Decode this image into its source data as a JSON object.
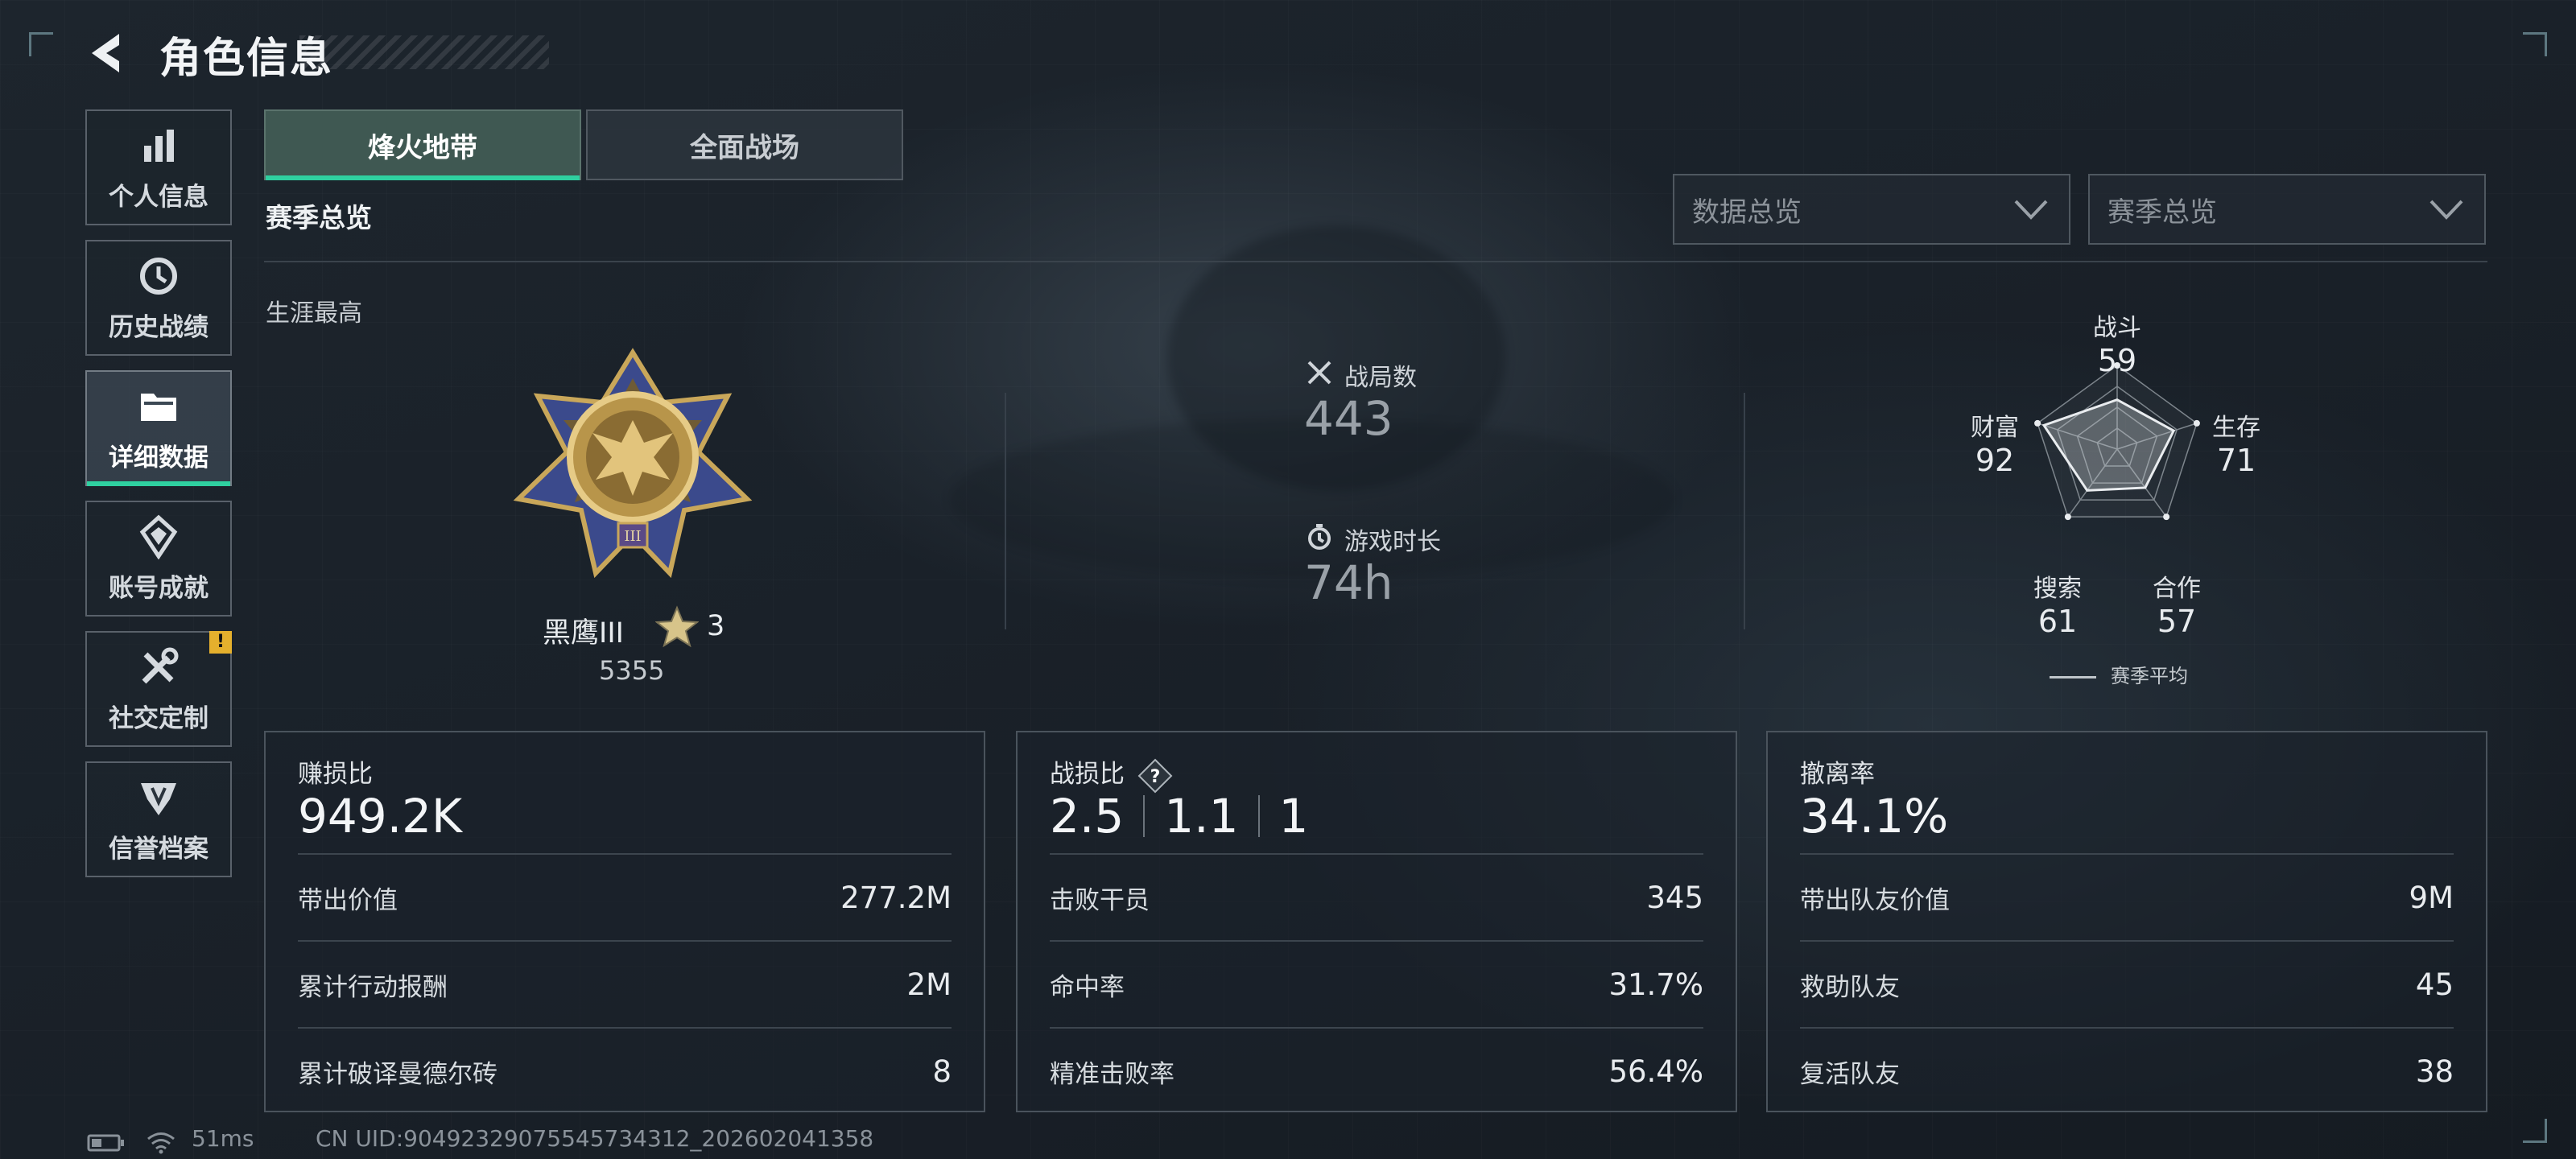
{
  "header": {
    "title": "角色信息"
  },
  "sidebar": {
    "items": [
      {
        "label": "个人信息",
        "icon": "bar-chart-icon"
      },
      {
        "label": "历史战绩",
        "icon": "history-clock-icon"
      },
      {
        "label": "详细数据",
        "icon": "folder-icon",
        "active": true
      },
      {
        "label": "账号成就",
        "icon": "achievement-icon"
      },
      {
        "label": "社交定制",
        "icon": "tools-icon",
        "badge": "!"
      },
      {
        "label": "信誉档案",
        "icon": "credit-emblem-icon"
      }
    ]
  },
  "tabs": [
    {
      "label": "烽火地带",
      "active": true
    },
    {
      "label": "全面战场"
    }
  ],
  "section_title": "赛季总览",
  "filters": {
    "data_overview": "数据总览",
    "season_overview": "赛季总览"
  },
  "career": {
    "label": "生涯最高",
    "rank_name": "黑鹰III",
    "stars": "3",
    "score": "5355"
  },
  "stats": {
    "matches_label": "战局数",
    "matches_value": "443",
    "playtime_label": "游戏时长",
    "playtime_value": "74h"
  },
  "radar": {
    "combat": {
      "label": "战斗",
      "value": "59"
    },
    "survival": {
      "label": "生存",
      "value": "71"
    },
    "teamwork": {
      "label": "合作",
      "value": "57"
    },
    "search": {
      "label": "搜索",
      "value": "61"
    },
    "wealth": {
      "label": "财富",
      "value": "92"
    },
    "legend": "赛季平均",
    "chart_data": {
      "type": "radar",
      "axes": [
        "战斗",
        "生存",
        "合作",
        "搜索",
        "财富"
      ],
      "values": [
        59,
        71,
        57,
        61,
        92
      ],
      "range": [
        0,
        100
      ]
    }
  },
  "cards": {
    "profit": {
      "title": "赚损比",
      "big": "949.2K",
      "rows": [
        {
          "k": "带出价值",
          "v": "277.2M"
        },
        {
          "k": "累计行动报酬",
          "v": "2M"
        },
        {
          "k": "累计破译曼德尔砖",
          "v": "8"
        }
      ]
    },
    "kd": {
      "title": "战损比",
      "big": [
        "2.5",
        "1.1",
        "1"
      ],
      "rows": [
        {
          "k": "击败干员",
          "v": "345"
        },
        {
          "k": "命中率",
          "v": "31.7%"
        },
        {
          "k": "精准击败率",
          "v": "56.4%"
        }
      ]
    },
    "extract": {
      "title": "撤离率",
      "big": "34.1%",
      "rows": [
        {
          "k": "带出队友价值",
          "v": "9M"
        },
        {
          "k": "救助队友",
          "v": "45"
        },
        {
          "k": "复活队友",
          "v": "38"
        }
      ]
    }
  },
  "footer": {
    "ping": "51ms",
    "uid": "CN UID:9049232907554573431​2_202602041358"
  },
  "colors": {
    "accent": "#2fd0a0",
    "badge": "#e5b02d"
  }
}
